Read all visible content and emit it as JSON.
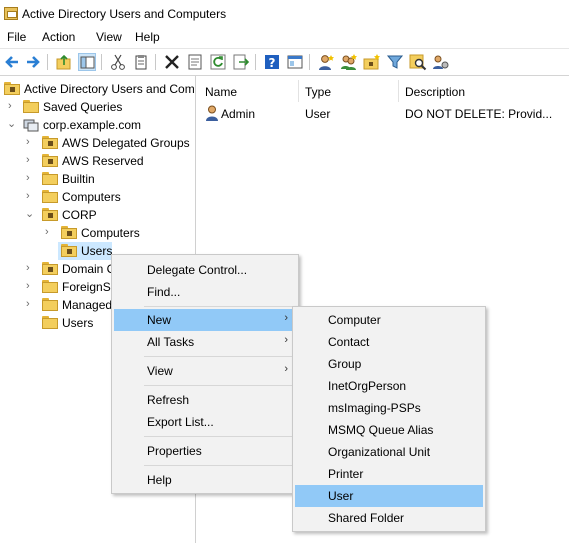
{
  "window": {
    "title": "Active Directory Users and Computers"
  },
  "menubar": {
    "items": [
      "File",
      "Action",
      "View",
      "Help"
    ]
  },
  "toolbar": {
    "buttons": [
      "back-icon",
      "forward-icon",
      "up-folder-icon",
      "show-hide-tree-icon",
      "cut-icon",
      "copy-icon",
      "delete-icon",
      "properties-icon",
      "refresh-icon",
      "export-icon",
      "help-icon",
      "console-icon",
      "new-user-icon",
      "new-group-icon",
      "new-ou-icon",
      "filter-icon",
      "find-icon",
      "delegate-icon"
    ]
  },
  "tree": {
    "root": "Active Directory Users and Com",
    "items": [
      {
        "label": "Saved Queries"
      },
      {
        "label": "corp.example.com"
      },
      {
        "label": "AWS Delegated Groups"
      },
      {
        "label": "AWS Reserved"
      },
      {
        "label": "Builtin"
      },
      {
        "label": "Computers"
      },
      {
        "label": "CORP"
      },
      {
        "label": "Computers"
      },
      {
        "label": "Users"
      },
      {
        "label": "Domain C"
      },
      {
        "label": "ForeignSe"
      },
      {
        "label": "Managed"
      },
      {
        "label": "Users"
      }
    ]
  },
  "list": {
    "columns": [
      "Name",
      "Type",
      "Description"
    ],
    "rows": [
      {
        "name": "Admin",
        "type": "User",
        "description": "DO NOT DELETE:  Provid..."
      }
    ]
  },
  "context_menu": {
    "items": [
      "Delegate Control...",
      "Find...",
      "New",
      "All Tasks",
      "View",
      "Refresh",
      "Export List...",
      "Properties",
      "Help"
    ]
  },
  "submenu_new": {
    "items": [
      "Computer",
      "Contact",
      "Group",
      "InetOrgPerson",
      "msImaging-PSPs",
      "MSMQ Queue Alias",
      "Organizational Unit",
      "Printer",
      "User",
      "Shared Folder"
    ],
    "highlighted": "User"
  },
  "colors": {
    "highlight": "#91c9f7",
    "tree_selected": "#cce8ff"
  }
}
